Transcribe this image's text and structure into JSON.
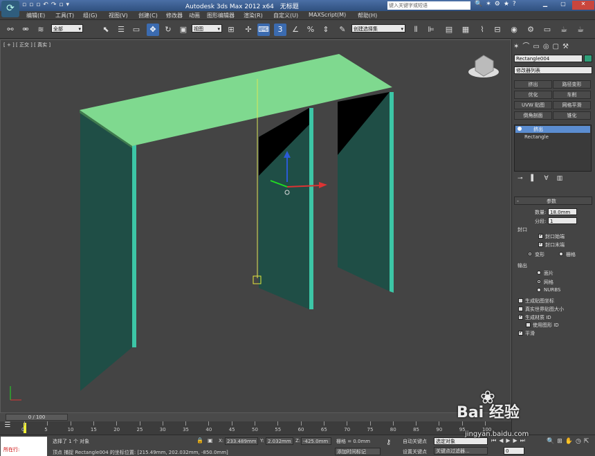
{
  "title": {
    "app": "Autodesk 3ds Max  2012 x64",
    "doc": "无标题",
    "search_placeholder": "键入关键字或短语"
  },
  "menu": [
    "编辑(E)",
    "工具(T)",
    "组(G)",
    "视图(V)",
    "创建(C)",
    "修改器",
    "动画",
    "图形编辑器",
    "渲染(R)",
    "自定义(U)",
    "MAXScript(M)",
    "帮助(H)"
  ],
  "toolbar": {
    "filter": "全部",
    "coord": "视图",
    "selset": "创建选择集"
  },
  "viewport": {
    "label": "[ + ] [ 正交 ] [ 真实 ]"
  },
  "panel": {
    "object_name": "Rectangle004",
    "modifier_list": "修改器列表",
    "mod_buttons": [
      "挤出",
      "路径变形",
      "优化",
      "车削",
      "UVW 贴图",
      "网格平滑",
      "倒角剖面",
      "锥化"
    ],
    "stack": [
      "挤出",
      "Rectangle"
    ],
    "rollout": "参数",
    "amount_label": "数量:",
    "amount": "18.0mm",
    "segments_label": "分段:",
    "segments": "1",
    "capping": "封口",
    "cap_start": "封口始端",
    "cap_end": "封口末端",
    "morph": "变形",
    "grid": "栅格",
    "output": "输出",
    "patch": "面片",
    "mesh": "网格",
    "nurbs": "NURBS",
    "gen_map": "生成贴图坐标",
    "real_world": "真实世界贴图大小",
    "gen_mat": "生成材质 ID",
    "use_shape": "使用图形 ID",
    "smooth": "平滑"
  },
  "timeline": {
    "frame": "0 / 100",
    "ticks": [
      "0",
      "5",
      "10",
      "15",
      "20",
      "25",
      "30",
      "35",
      "40",
      "45",
      "50",
      "55",
      "60",
      "65",
      "70",
      "75",
      "80",
      "85",
      "90",
      "95",
      "100"
    ]
  },
  "status": {
    "mode": "所在行:",
    "selected": "选择了 1 个 对象",
    "prompt": "顶点 捕捉 Rectangle004 的坐标位置: [215.49mm, 202.032mm, -850.0mm]",
    "x_label": "X:",
    "x": "233.489mm",
    "y_label": "Y:",
    "y": "2.032mm",
    "z_label": "Z:",
    "z": "-425.0mm",
    "grid": "栅格 = 0.0mm",
    "add_tag": "添加时间标记",
    "auto_key": "自动关键点",
    "set_key": "设置关键点",
    "sel_obj": "选定对象",
    "key_filter": "关键点过滤器...",
    "frame_num": "0"
  },
  "watermark": {
    "brand": "Bai  经验",
    "url": "jingyan.baidu.com"
  },
  "colors": {
    "table_top": "#7fd98f",
    "table_side": "#1f4e46",
    "edge": "#3cc6a6"
  }
}
